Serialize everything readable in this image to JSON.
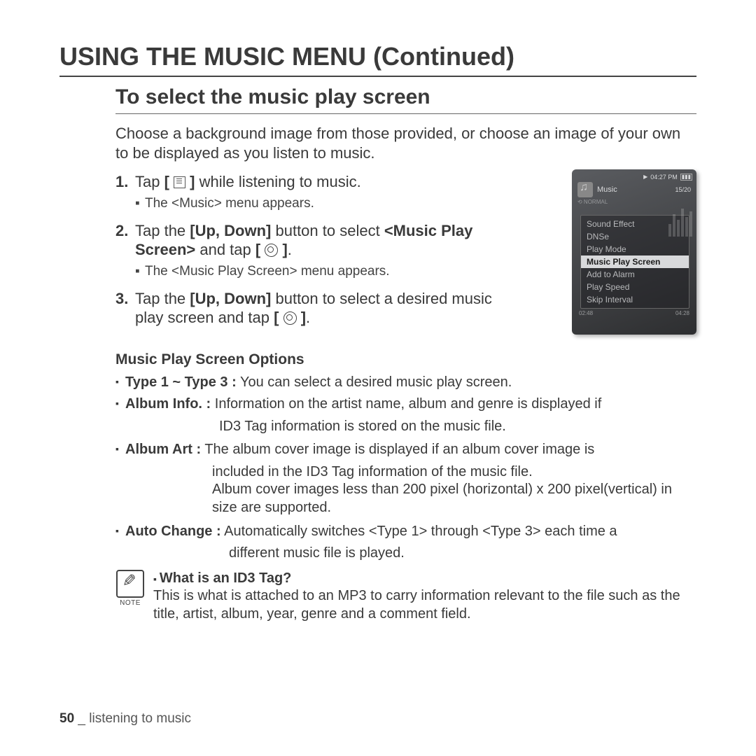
{
  "title": "USING THE MUSIC MENU (Continued)",
  "subtitle": "To select the music play screen",
  "intro": "Choose a background image from those provided, or choose an image of your own to be displayed as you listen to music.",
  "steps": {
    "s1_pre": "Tap ",
    "s1_post": " while listening to music.",
    "s1_sub": "The <Music> menu appears.",
    "s2a": "Tap the ",
    "s2_updown": "[Up, Down]",
    "s2b": " button to select ",
    "s2_mps": "<Music Play Screen>",
    "s2c": " and tap ",
    "s2_sub": "The <Music Play Screen> menu appears.",
    "s3a": "Tap the ",
    "s3b": " button to select a desired music play screen and tap "
  },
  "device": {
    "time": "04:27 PM",
    "music_label": "Music",
    "track_count": "15/20",
    "normal": "⟲ NORMAL",
    "menu": [
      "Sound Effect",
      "DNSe",
      "Play Mode",
      "Music Play Screen",
      "Add to Alarm",
      "Play Speed",
      "Skip Interval"
    ],
    "selected_index": 3,
    "t_left": "02:48",
    "t_right": "04:28"
  },
  "options_title": "Music Play Screen Options",
  "options": {
    "o1_label": "Type 1 ~ Type 3 :",
    "o1_text": " You can select a desired music play screen.",
    "o2_label": "Album Info. :",
    "o2_text": " Information on the artist name, album and genre is displayed if",
    "o2_cont": "ID3 Tag information is stored on the music file.",
    "o3_label": "Album Art :",
    "o3_text": " The album cover image is displayed if an album cover image is",
    "o3_cont": "included in the ID3 Tag information of the music file.\nAlbum cover images less than 200 pixel (horizontal) x 200 pixel(vertical) in size are supported.",
    "o4_label": "Auto Change :",
    "o4_text": " Automatically switches <Type 1> through <Type 3> each time a",
    "o4_cont": "different music file is played."
  },
  "note": {
    "label": "NOTE",
    "q": "What is an ID3 Tag?",
    "body": "This is what is attached to an MP3 to carry information relevant to the file such as the title, artist, album, year, genre and a comment field."
  },
  "footer": {
    "page": "50",
    "sep": " _ ",
    "section": "listening to music"
  }
}
